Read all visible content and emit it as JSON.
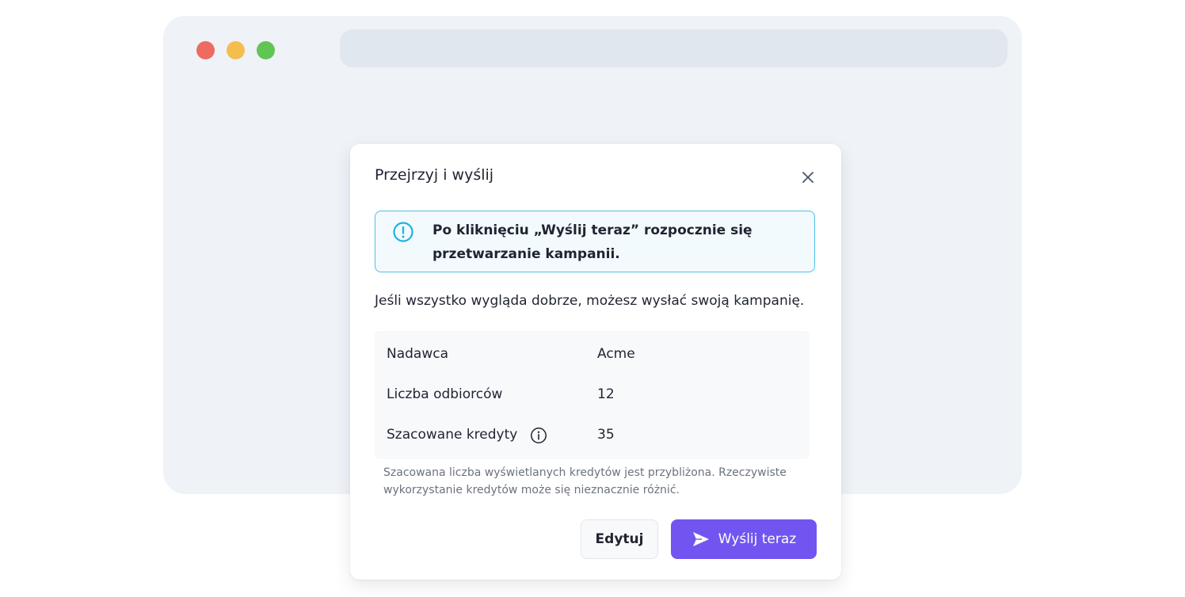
{
  "window": {
    "traffic_lights": [
      "close",
      "minimize",
      "maximize"
    ],
    "colors": {
      "red": "#ee6b60",
      "yellow": "#f5bd4f",
      "green": "#61c554"
    }
  },
  "dialog": {
    "title": "Przejrzyj i wyślij",
    "close_icon": "close-icon",
    "alert": {
      "icon": "exclamation-circle-icon",
      "text": "Po kliknięciu „Wyślij teraz” rozpocznie się przetwarzanie kampanii."
    },
    "intro": "Jeśli wszystko wygląda dobrze, możesz wysłać swoją kampanię.",
    "summary": [
      {
        "label": "Nadawca",
        "value": "Acme"
      },
      {
        "label": "Liczba odbiorców",
        "value": "12"
      },
      {
        "label": "Szacowane kredyty",
        "value": "35",
        "icon": "info-icon"
      }
    ],
    "note": "Szacowana liczba wyświetlanych kredytów jest przybliżona. Rzeczywiste wykorzystanie kredytów może się nieznacznie różnić.",
    "buttons": {
      "edit": "Edytuj",
      "send": "Wyślij teraz",
      "send_icon": "send-icon"
    }
  },
  "colors": {
    "accent": "#7255f0",
    "alert_border": "#4cc0e8",
    "alert_bg": "#f2fafe"
  }
}
